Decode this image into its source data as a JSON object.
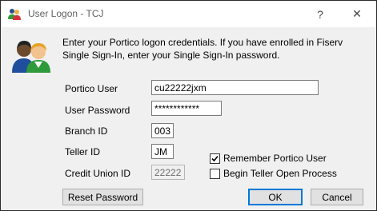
{
  "window": {
    "title": "User Logon - TCJ",
    "help_glyph": "?",
    "close_glyph": "✕",
    "title_icon": "users-icon",
    "avatar_icon": "users-avatar-icon"
  },
  "instructions": "Enter your Portico logon credentials. If you have enrolled in Fiserv Single Sign-In, enter your Single Sign-In password.",
  "fields": {
    "portico_user": {
      "label": "Portico User",
      "value": "cu22222jxm"
    },
    "user_password": {
      "label": "User Password",
      "value": "************"
    },
    "branch_id": {
      "label": "Branch ID",
      "value": "003"
    },
    "teller_id": {
      "label": "Teller ID",
      "value": "JM"
    },
    "credit_union_id": {
      "label": "Credit Union ID",
      "value": "22222"
    }
  },
  "options": {
    "remember_user": {
      "label": "Remember Portico User",
      "checked": true
    },
    "begin_teller": {
      "label": "Begin Teller Open Process",
      "checked": false
    }
  },
  "buttons": {
    "reset_password": "Reset Password",
    "ok": "OK",
    "cancel": "Cancel"
  },
  "colors": {
    "accent": "#0078d7",
    "check_mark": "#000000"
  }
}
